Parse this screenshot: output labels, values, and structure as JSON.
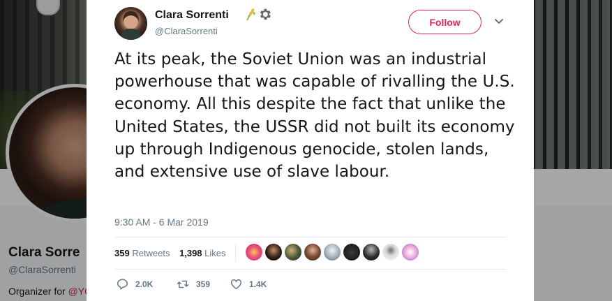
{
  "background_profile": {
    "name": "Clara Sorre",
    "handle": "@ClaraSorrenti",
    "bio_prefix": "Organizer for ",
    "bio_link": "@YC"
  },
  "tweet": {
    "author_name": "Clara Sorrenti",
    "author_handle": "@ClaraSorrenti",
    "follow_label": "Follow",
    "text": "At its peak, the Soviet Union was an industrial powerhouse that was capable of rivalling the U.S. economy. All this despite the fact that unlike the United States, the USSR did not built its economy up through Indigenous genocide, stolen lands, and extensive use of slave labour.",
    "timestamp": "9:30 AM - 6 Mar 2019",
    "retweets_count": "359",
    "retweets_label": "Retweets",
    "likes_count": "1,398",
    "likes_label": "Likes",
    "replies_short": "2.0K",
    "retweets_short": "359",
    "likes_short": "1.4K"
  },
  "colors": {
    "follow_accent": "#e0245e",
    "text_primary": "#14171a",
    "text_secondary": "#657786",
    "divider": "#e6ecf0"
  },
  "icons": [
    "wheat-icon",
    "gear-icon",
    "chevron-down-icon",
    "reply-icon",
    "retweet-icon",
    "heart-icon"
  ]
}
